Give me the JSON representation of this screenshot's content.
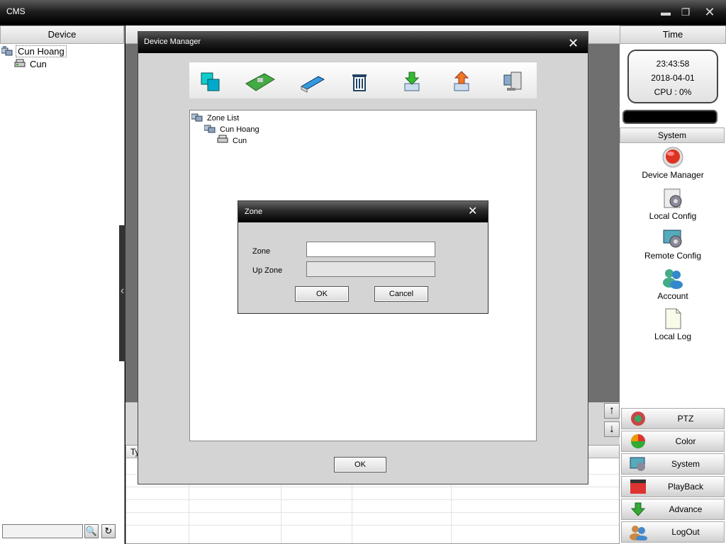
{
  "window": {
    "title": "CMS",
    "minimize": "▬",
    "maximize": "❐",
    "close": "✕"
  },
  "left_panel": {
    "header": "Device",
    "tree": [
      {
        "label": "Cun Hoang",
        "icon": "zone-icon"
      },
      {
        "label": "Cun",
        "icon": "device-icon"
      }
    ],
    "search_placeholder": "",
    "search_icon": "🔍",
    "refresh_icon": "↻"
  },
  "center": {
    "collapse_icon": "‹",
    "log_table": {
      "first_column": "Ty"
    },
    "arrow_up": "↑",
    "arrow_down": "↓"
  },
  "right_panel": {
    "time_header": "Time",
    "clock": {
      "time": "23:43:58",
      "date": "2018-04-01",
      "cpu": "CPU : 0%"
    },
    "system_header": "System",
    "system_items": [
      {
        "label": "Device Manager",
        "icon": "device-manager-icon"
      },
      {
        "label": "Local Config",
        "icon": "local-config-icon"
      },
      {
        "label": "Remote Config",
        "icon": "remote-config-icon"
      },
      {
        "label": "Account",
        "icon": "account-icon"
      },
      {
        "label": "Local Log",
        "icon": "local-log-icon"
      }
    ],
    "bottom_buttons": [
      {
        "label": "PTZ",
        "icon": "ptz-icon"
      },
      {
        "label": "Color",
        "icon": "color-icon"
      },
      {
        "label": "System",
        "icon": "system-icon"
      },
      {
        "label": "PlayBack",
        "icon": "playback-icon"
      },
      {
        "label": "Advance",
        "icon": "advance-icon"
      },
      {
        "label": "LogOut",
        "icon": "logout-icon"
      }
    ]
  },
  "device_manager": {
    "title": "Device Manager",
    "close": "✕",
    "toolbar": [
      "add-zone-icon",
      "add-device-icon",
      "modify-icon",
      "delete-icon",
      "import-icon",
      "export-icon",
      "connect-icon"
    ],
    "tree": [
      {
        "label": "Zone List"
      },
      {
        "label": "Cun Hoang"
      },
      {
        "label": "Cun"
      }
    ],
    "ok": "OK"
  },
  "zone_dialog": {
    "title": "Zone",
    "close": "✕",
    "zone_label": "Zone",
    "zone_value": "",
    "upzone_label": "Up Zone",
    "upzone_value": "",
    "ok": "OK",
    "cancel": "Cancel"
  }
}
